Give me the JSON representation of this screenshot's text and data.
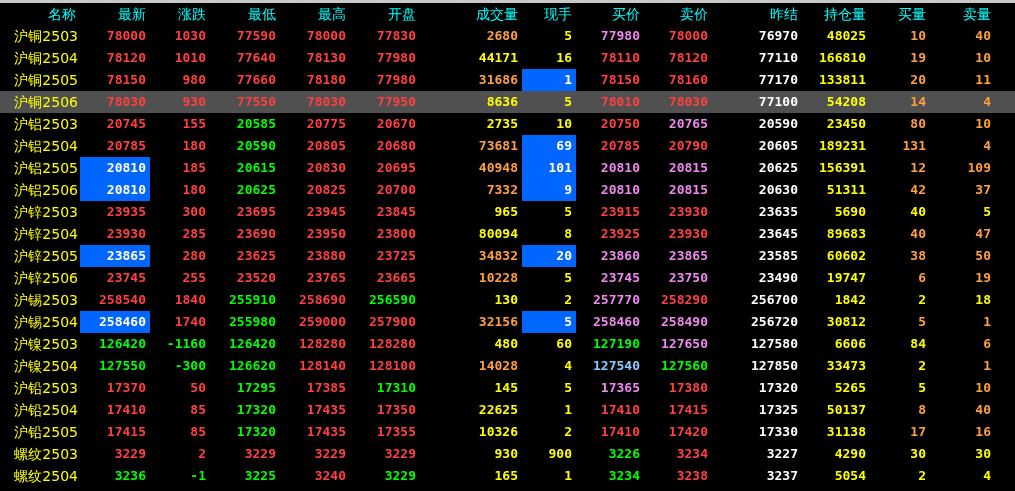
{
  "table": {
    "name_header": "名称",
    "columns": [
      {
        "label": "最新"
      },
      {
        "label": "涨跌"
      },
      {
        "label": "最低"
      },
      {
        "label": "最高"
      },
      {
        "label": "开盘"
      },
      {
        "label": "成交量"
      },
      {
        "label": "现手"
      },
      {
        "label": "买价"
      },
      {
        "label": "卖价"
      },
      {
        "label": "昨结"
      },
      {
        "label": "持仓量"
      },
      {
        "label": "买量"
      },
      {
        "label": "卖量"
      }
    ],
    "rows": [
      {
        "name": "沪铜2503",
        "selected": false,
        "cells": [
          {
            "text": "78000",
            "color": "#ff4040",
            "highlighted": false
          },
          {
            "text": "1030",
            "color": "#ff4040",
            "highlighted": false
          },
          {
            "text": "77590",
            "color": "#ff4040",
            "highlighted": false
          },
          {
            "text": "78000",
            "color": "#ff4040",
            "highlighted": false
          },
          {
            "text": "77830",
            "color": "#ff4040",
            "highlighted": false
          },
          {
            "text": "2680",
            "color": "#ffa040",
            "highlighted": false
          },
          {
            "text": "5",
            "color": "#ffff00",
            "highlighted": false
          },
          {
            "text": "77980",
            "color": "#ee88ee",
            "highlighted": false
          },
          {
            "text": "78000",
            "color": "#ff4040",
            "highlighted": false
          },
          {
            "text": "76970",
            "color": "#ffffff",
            "highlighted": false
          },
          {
            "text": "48025",
            "color": "#ffff00",
            "highlighted": false
          },
          {
            "text": "10",
            "color": "#ffa040",
            "highlighted": false
          },
          {
            "text": "40",
            "color": "#ffa040",
            "highlighted": false
          }
        ]
      },
      {
        "name": "沪铜2504",
        "selected": false,
        "cells": [
          {
            "text": "78120",
            "color": "#ff4040",
            "highlighted": false
          },
          {
            "text": "1010",
            "color": "#ff4040",
            "highlighted": false
          },
          {
            "text": "77640",
            "color": "#ff4040",
            "highlighted": false
          },
          {
            "text": "78130",
            "color": "#ff4040",
            "highlighted": false
          },
          {
            "text": "77980",
            "color": "#ff4040",
            "highlighted": false
          },
          {
            "text": "44171",
            "color": "#ffff00",
            "highlighted": false
          },
          {
            "text": "16",
            "color": "#ffff00",
            "highlighted": false
          },
          {
            "text": "78110",
            "color": "#ff4040",
            "highlighted": false
          },
          {
            "text": "78120",
            "color": "#ff4040",
            "highlighted": false
          },
          {
            "text": "77110",
            "color": "#ffffff",
            "highlighted": false
          },
          {
            "text": "166810",
            "color": "#ffff00",
            "highlighted": false
          },
          {
            "text": "19",
            "color": "#ffa040",
            "highlighted": false
          },
          {
            "text": "10",
            "color": "#ffa040",
            "highlighted": false
          }
        ]
      },
      {
        "name": "沪铜2505",
        "selected": false,
        "cells": [
          {
            "text": "78150",
            "color": "#ff4040",
            "highlighted": false
          },
          {
            "text": "980",
            "color": "#ff4040",
            "highlighted": false
          },
          {
            "text": "77660",
            "color": "#ff4040",
            "highlighted": false
          },
          {
            "text": "78180",
            "color": "#ff4040",
            "highlighted": false
          },
          {
            "text": "77980",
            "color": "#ff4040",
            "highlighted": false
          },
          {
            "text": "31686",
            "color": "#ffa040",
            "highlighted": false
          },
          {
            "text": "1",
            "color": "#ffffff",
            "highlighted": true
          },
          {
            "text": "78150",
            "color": "#ff4040",
            "highlighted": false
          },
          {
            "text": "78160",
            "color": "#ff4040",
            "highlighted": false
          },
          {
            "text": "77170",
            "color": "#ffffff",
            "highlighted": false
          },
          {
            "text": "133811",
            "color": "#ffff00",
            "highlighted": false
          },
          {
            "text": "20",
            "color": "#ffa040",
            "highlighted": false
          },
          {
            "text": "11",
            "color": "#ffa040",
            "highlighted": false
          }
        ]
      },
      {
        "name": "沪铜2506",
        "selected": true,
        "cells": [
          {
            "text": "78030",
            "color": "#ff4040",
            "highlighted": false
          },
          {
            "text": "930",
            "color": "#ff4040",
            "highlighted": false
          },
          {
            "text": "77550",
            "color": "#ff4040",
            "highlighted": false
          },
          {
            "text": "78030",
            "color": "#ff4040",
            "highlighted": false
          },
          {
            "text": "77950",
            "color": "#ff4040",
            "highlighted": false
          },
          {
            "text": "8636",
            "color": "#ffff00",
            "highlighted": false
          },
          {
            "text": "5",
            "color": "#ffff00",
            "highlighted": false
          },
          {
            "text": "78010",
            "color": "#ff4040",
            "highlighted": false
          },
          {
            "text": "78030",
            "color": "#ff4040",
            "highlighted": false
          },
          {
            "text": "77100",
            "color": "#ffffff",
            "highlighted": false
          },
          {
            "text": "54208",
            "color": "#ffff00",
            "highlighted": false
          },
          {
            "text": "14",
            "color": "#ffa040",
            "highlighted": false
          },
          {
            "text": "4",
            "color": "#ffa040",
            "highlighted": false
          }
        ]
      },
      {
        "name": "沪铝2503",
        "selected": false,
        "cells": [
          {
            "text": "20745",
            "color": "#ff4040",
            "highlighted": false
          },
          {
            "text": "155",
            "color": "#ff4040",
            "highlighted": false
          },
          {
            "text": "20585",
            "color": "#00ff00",
            "highlighted": false
          },
          {
            "text": "20775",
            "color": "#ff4040",
            "highlighted": false
          },
          {
            "text": "20670",
            "color": "#ff4040",
            "highlighted": false
          },
          {
            "text": "2735",
            "color": "#ffff00",
            "highlighted": false
          },
          {
            "text": "10",
            "color": "#ffff00",
            "highlighted": false
          },
          {
            "text": "20750",
            "color": "#ff4040",
            "highlighted": false
          },
          {
            "text": "20765",
            "color": "#ee88ee",
            "highlighted": false
          },
          {
            "text": "20590",
            "color": "#ffffff",
            "highlighted": false
          },
          {
            "text": "23450",
            "color": "#ffff00",
            "highlighted": false
          },
          {
            "text": "80",
            "color": "#ffa040",
            "highlighted": false
          },
          {
            "text": "10",
            "color": "#ffa040",
            "highlighted": false
          }
        ]
      },
      {
        "name": "沪铝2504",
        "selected": false,
        "cells": [
          {
            "text": "20785",
            "color": "#ff4040",
            "highlighted": false
          },
          {
            "text": "180",
            "color": "#ff4040",
            "highlighted": false
          },
          {
            "text": "20590",
            "color": "#00ff00",
            "highlighted": false
          },
          {
            "text": "20805",
            "color": "#ff4040",
            "highlighted": false
          },
          {
            "text": "20680",
            "color": "#ff4040",
            "highlighted": false
          },
          {
            "text": "73681",
            "color": "#ffa040",
            "highlighted": false
          },
          {
            "text": "69",
            "color": "#ffffff",
            "highlighted": true
          },
          {
            "text": "20785",
            "color": "#ff4040",
            "highlighted": false
          },
          {
            "text": "20790",
            "color": "#ff4040",
            "highlighted": false
          },
          {
            "text": "20605",
            "color": "#ffffff",
            "highlighted": false
          },
          {
            "text": "189231",
            "color": "#ffff00",
            "highlighted": false
          },
          {
            "text": "131",
            "color": "#ffa040",
            "highlighted": false
          },
          {
            "text": "4",
            "color": "#ffa040",
            "highlighted": false
          }
        ]
      },
      {
        "name": "沪铝2505",
        "selected": false,
        "cells": [
          {
            "text": "20810",
            "color": "#ffffff",
            "highlighted": true
          },
          {
            "text": "185",
            "color": "#ff4040",
            "highlighted": false
          },
          {
            "text": "20615",
            "color": "#00ff00",
            "highlighted": false
          },
          {
            "text": "20830",
            "color": "#ff4040",
            "highlighted": false
          },
          {
            "text": "20695",
            "color": "#ff4040",
            "highlighted": false
          },
          {
            "text": "40948",
            "color": "#ffa040",
            "highlighted": false
          },
          {
            "text": "101",
            "color": "#ffffff",
            "highlighted": true
          },
          {
            "text": "20810",
            "color": "#ee88ee",
            "highlighted": false
          },
          {
            "text": "20815",
            "color": "#ee88ee",
            "highlighted": false
          },
          {
            "text": "20625",
            "color": "#ffffff",
            "highlighted": false
          },
          {
            "text": "156391",
            "color": "#ffff00",
            "highlighted": false
          },
          {
            "text": "12",
            "color": "#ffa040",
            "highlighted": false
          },
          {
            "text": "109",
            "color": "#ffa040",
            "highlighted": false
          }
        ]
      },
      {
        "name": "沪铝2506",
        "selected": false,
        "cells": [
          {
            "text": "20810",
            "color": "#ffffff",
            "highlighted": true
          },
          {
            "text": "180",
            "color": "#ff4040",
            "highlighted": false
          },
          {
            "text": "20625",
            "color": "#00ff00",
            "highlighted": false
          },
          {
            "text": "20825",
            "color": "#ff4040",
            "highlighted": false
          },
          {
            "text": "20700",
            "color": "#ff4040",
            "highlighted": false
          },
          {
            "text": "7332",
            "color": "#ffa040",
            "highlighted": false
          },
          {
            "text": "9",
            "color": "#ffffff",
            "highlighted": true
          },
          {
            "text": "20810",
            "color": "#ee88ee",
            "highlighted": false
          },
          {
            "text": "20815",
            "color": "#ee88ee",
            "highlighted": false
          },
          {
            "text": "20630",
            "color": "#ffffff",
            "highlighted": false
          },
          {
            "text": "51311",
            "color": "#ffff00",
            "highlighted": false
          },
          {
            "text": "42",
            "color": "#ffa040",
            "highlighted": false
          },
          {
            "text": "37",
            "color": "#ffa040",
            "highlighted": false
          }
        ]
      },
      {
        "name": "沪锌2503",
        "selected": false,
        "cells": [
          {
            "text": "23935",
            "color": "#ff4040",
            "highlighted": false
          },
          {
            "text": "300",
            "color": "#ff4040",
            "highlighted": false
          },
          {
            "text": "23695",
            "color": "#ff4040",
            "highlighted": false
          },
          {
            "text": "23945",
            "color": "#ff4040",
            "highlighted": false
          },
          {
            "text": "23845",
            "color": "#ff4040",
            "highlighted": false
          },
          {
            "text": "965",
            "color": "#ffff00",
            "highlighted": false
          },
          {
            "text": "5",
            "color": "#ffff00",
            "highlighted": false
          },
          {
            "text": "23915",
            "color": "#ff4040",
            "highlighted": false
          },
          {
            "text": "23930",
            "color": "#ff4040",
            "highlighted": false
          },
          {
            "text": "23635",
            "color": "#ffffff",
            "highlighted": false
          },
          {
            "text": "5690",
            "color": "#ffff00",
            "highlighted": false
          },
          {
            "text": "40",
            "color": "#ffff00",
            "highlighted": false
          },
          {
            "text": "5",
            "color": "#ffff00",
            "highlighted": false
          }
        ]
      },
      {
        "name": "沪锌2504",
        "selected": false,
        "cells": [
          {
            "text": "23930",
            "color": "#ff4040",
            "highlighted": false
          },
          {
            "text": "285",
            "color": "#ff4040",
            "highlighted": false
          },
          {
            "text": "23690",
            "color": "#ff4040",
            "highlighted": false
          },
          {
            "text": "23950",
            "color": "#ff4040",
            "highlighted": false
          },
          {
            "text": "23800",
            "color": "#ff4040",
            "highlighted": false
          },
          {
            "text": "80094",
            "color": "#ffff00",
            "highlighted": false
          },
          {
            "text": "8",
            "color": "#ffff00",
            "highlighted": false
          },
          {
            "text": "23925",
            "color": "#ff4040",
            "highlighted": false
          },
          {
            "text": "23930",
            "color": "#ff4040",
            "highlighted": false
          },
          {
            "text": "23645",
            "color": "#ffffff",
            "highlighted": false
          },
          {
            "text": "89683",
            "color": "#ffff00",
            "highlighted": false
          },
          {
            "text": "40",
            "color": "#ffa040",
            "highlighted": false
          },
          {
            "text": "47",
            "color": "#ffa040",
            "highlighted": false
          }
        ]
      },
      {
        "name": "沪锌2505",
        "selected": false,
        "cells": [
          {
            "text": "23865",
            "color": "#ffffff",
            "highlighted": true
          },
          {
            "text": "280",
            "color": "#ff4040",
            "highlighted": false
          },
          {
            "text": "23625",
            "color": "#ff4040",
            "highlighted": false
          },
          {
            "text": "23880",
            "color": "#ff4040",
            "highlighted": false
          },
          {
            "text": "23725",
            "color": "#ff4040",
            "highlighted": false
          },
          {
            "text": "34832",
            "color": "#ffa040",
            "highlighted": false
          },
          {
            "text": "20",
            "color": "#ffffff",
            "highlighted": true
          },
          {
            "text": "23860",
            "color": "#ee88ee",
            "highlighted": false
          },
          {
            "text": "23865",
            "color": "#ee88ee",
            "highlighted": false
          },
          {
            "text": "23585",
            "color": "#ffffff",
            "highlighted": false
          },
          {
            "text": "60602",
            "color": "#ffff00",
            "highlighted": false
          },
          {
            "text": "38",
            "color": "#ffa040",
            "highlighted": false
          },
          {
            "text": "50",
            "color": "#ffa040",
            "highlighted": false
          }
        ]
      },
      {
        "name": "沪锌2506",
        "selected": false,
        "cells": [
          {
            "text": "23745",
            "color": "#ff4040",
            "highlighted": false
          },
          {
            "text": "255",
            "color": "#ff4040",
            "highlighted": false
          },
          {
            "text": "23520",
            "color": "#ff4040",
            "highlighted": false
          },
          {
            "text": "23765",
            "color": "#ff4040",
            "highlighted": false
          },
          {
            "text": "23665",
            "color": "#ff4040",
            "highlighted": false
          },
          {
            "text": "10228",
            "color": "#ffa040",
            "highlighted": false
          },
          {
            "text": "5",
            "color": "#ffff00",
            "highlighted": false
          },
          {
            "text": "23745",
            "color": "#ee88ee",
            "highlighted": false
          },
          {
            "text": "23750",
            "color": "#ee88ee",
            "highlighted": false
          },
          {
            "text": "23490",
            "color": "#ffffff",
            "highlighted": false
          },
          {
            "text": "19747",
            "color": "#ffff00",
            "highlighted": false
          },
          {
            "text": "6",
            "color": "#ffa040",
            "highlighted": false
          },
          {
            "text": "19",
            "color": "#ffa040",
            "highlighted": false
          }
        ]
      },
      {
        "name": "沪锡2503",
        "selected": false,
        "cells": [
          {
            "text": "258540",
            "color": "#ff4040",
            "highlighted": false
          },
          {
            "text": "1840",
            "color": "#ff4040",
            "highlighted": false
          },
          {
            "text": "255910",
            "color": "#00ff00",
            "highlighted": false
          },
          {
            "text": "258690",
            "color": "#ff4040",
            "highlighted": false
          },
          {
            "text": "256590",
            "color": "#00ff00",
            "highlighted": false
          },
          {
            "text": "130",
            "color": "#ffff00",
            "highlighted": false
          },
          {
            "text": "2",
            "color": "#ffff00",
            "highlighted": false
          },
          {
            "text": "257770",
            "color": "#ee88ee",
            "highlighted": false
          },
          {
            "text": "258290",
            "color": "#ff4040",
            "highlighted": false
          },
          {
            "text": "256700",
            "color": "#ffffff",
            "highlighted": false
          },
          {
            "text": "1842",
            "color": "#ffff00",
            "highlighted": false
          },
          {
            "text": "2",
            "color": "#ffff00",
            "highlighted": false
          },
          {
            "text": "18",
            "color": "#ffff00",
            "highlighted": false
          }
        ]
      },
      {
        "name": "沪锡2504",
        "selected": false,
        "cells": [
          {
            "text": "258460",
            "color": "#ffffff",
            "highlighted": true
          },
          {
            "text": "1740",
            "color": "#ff4040",
            "highlighted": false
          },
          {
            "text": "255980",
            "color": "#00ff00",
            "highlighted": false
          },
          {
            "text": "259000",
            "color": "#ff4040",
            "highlighted": false
          },
          {
            "text": "257900",
            "color": "#ff4040",
            "highlighted": false
          },
          {
            "text": "32156",
            "color": "#ffa040",
            "highlighted": false
          },
          {
            "text": "5",
            "color": "#ffffff",
            "highlighted": true
          },
          {
            "text": "258460",
            "color": "#ee88ee",
            "highlighted": false
          },
          {
            "text": "258490",
            "color": "#ee88ee",
            "highlighted": false
          },
          {
            "text": "256720",
            "color": "#ffffff",
            "highlighted": false
          },
          {
            "text": "30812",
            "color": "#ffff00",
            "highlighted": false
          },
          {
            "text": "5",
            "color": "#ffa040",
            "highlighted": false
          },
          {
            "text": "1",
            "color": "#ffa040",
            "highlighted": false
          }
        ]
      },
      {
        "name": "沪镍2503",
        "selected": false,
        "cells": [
          {
            "text": "126420",
            "color": "#00ff00",
            "highlighted": false
          },
          {
            "text": "-1160",
            "color": "#00ff00",
            "highlighted": false
          },
          {
            "text": "126420",
            "color": "#00ff00",
            "highlighted": false
          },
          {
            "text": "128280",
            "color": "#ff4040",
            "highlighted": false
          },
          {
            "text": "128280",
            "color": "#ff4040",
            "highlighted": false
          },
          {
            "text": "480",
            "color": "#ffff00",
            "highlighted": false
          },
          {
            "text": "60",
            "color": "#ffff00",
            "highlighted": false
          },
          {
            "text": "127190",
            "color": "#00ff00",
            "highlighted": false
          },
          {
            "text": "127650",
            "color": "#ee88ee",
            "highlighted": false
          },
          {
            "text": "127580",
            "color": "#ffffff",
            "highlighted": false
          },
          {
            "text": "6606",
            "color": "#ffff00",
            "highlighted": false
          },
          {
            "text": "84",
            "color": "#ffff00",
            "highlighted": false
          },
          {
            "text": "6",
            "color": "#ffa040",
            "highlighted": false
          }
        ]
      },
      {
        "name": "沪镍2504",
        "selected": false,
        "cells": [
          {
            "text": "127550",
            "color": "#00ff00",
            "highlighted": false
          },
          {
            "text": "-300",
            "color": "#00ff00",
            "highlighted": false
          },
          {
            "text": "126620",
            "color": "#00ff00",
            "highlighted": false
          },
          {
            "text": "128140",
            "color": "#ff4040",
            "highlighted": false
          },
          {
            "text": "128100",
            "color": "#ff4040",
            "highlighted": false
          },
          {
            "text": "14028",
            "color": "#ffa040",
            "highlighted": false
          },
          {
            "text": "4",
            "color": "#ffff00",
            "highlighted": false
          },
          {
            "text": "127540",
            "color": "#88ccff",
            "highlighted": false
          },
          {
            "text": "127560",
            "color": "#00ff00",
            "highlighted": false
          },
          {
            "text": "127850",
            "color": "#ffffff",
            "highlighted": false
          },
          {
            "text": "33473",
            "color": "#ffff00",
            "highlighted": false
          },
          {
            "text": "2",
            "color": "#ffff00",
            "highlighted": false
          },
          {
            "text": "1",
            "color": "#ffa040",
            "highlighted": false
          }
        ]
      },
      {
        "name": "沪铅2503",
        "selected": false,
        "cells": [
          {
            "text": "17370",
            "color": "#ff4040",
            "highlighted": false
          },
          {
            "text": "50",
            "color": "#ff4040",
            "highlighted": false
          },
          {
            "text": "17295",
            "color": "#00ff00",
            "highlighted": false
          },
          {
            "text": "17385",
            "color": "#ff4040",
            "highlighted": false
          },
          {
            "text": "17310",
            "color": "#00ff00",
            "highlighted": false
          },
          {
            "text": "145",
            "color": "#ffff00",
            "highlighted": false
          },
          {
            "text": "5",
            "color": "#ffff00",
            "highlighted": false
          },
          {
            "text": "17365",
            "color": "#ee88ee",
            "highlighted": false
          },
          {
            "text": "17380",
            "color": "#ff4040",
            "highlighted": false
          },
          {
            "text": "17320",
            "color": "#ffffff",
            "highlighted": false
          },
          {
            "text": "5265",
            "color": "#ffff00",
            "highlighted": false
          },
          {
            "text": "5",
            "color": "#ffff00",
            "highlighted": false
          },
          {
            "text": "10",
            "color": "#ffa040",
            "highlighted": false
          }
        ]
      },
      {
        "name": "沪铅2504",
        "selected": false,
        "cells": [
          {
            "text": "17410",
            "color": "#ff4040",
            "highlighted": false
          },
          {
            "text": "85",
            "color": "#ff4040",
            "highlighted": false
          },
          {
            "text": "17320",
            "color": "#00ff00",
            "highlighted": false
          },
          {
            "text": "17435",
            "color": "#ff4040",
            "highlighted": false
          },
          {
            "text": "17350",
            "color": "#ff4040",
            "highlighted": false
          },
          {
            "text": "22625",
            "color": "#ffff00",
            "highlighted": false
          },
          {
            "text": "1",
            "color": "#ffff00",
            "highlighted": false
          },
          {
            "text": "17410",
            "color": "#ff4040",
            "highlighted": false
          },
          {
            "text": "17415",
            "color": "#ff4040",
            "highlighted": false
          },
          {
            "text": "17325",
            "color": "#ffffff",
            "highlighted": false
          },
          {
            "text": "50137",
            "color": "#ffff00",
            "highlighted": false
          },
          {
            "text": "8",
            "color": "#ffa040",
            "highlighted": false
          },
          {
            "text": "40",
            "color": "#ffa040",
            "highlighted": false
          }
        ]
      },
      {
        "name": "沪铅2505",
        "selected": false,
        "cells": [
          {
            "text": "17415",
            "color": "#ff4040",
            "highlighted": false
          },
          {
            "text": "85",
            "color": "#ff4040",
            "highlighted": false
          },
          {
            "text": "17320",
            "color": "#00ff00",
            "highlighted": false
          },
          {
            "text": "17435",
            "color": "#ff4040",
            "highlighted": false
          },
          {
            "text": "17355",
            "color": "#ff4040",
            "highlighted": false
          },
          {
            "text": "10326",
            "color": "#ffff00",
            "highlighted": false
          },
          {
            "text": "2",
            "color": "#ffff00",
            "highlighted": false
          },
          {
            "text": "17410",
            "color": "#ff4040",
            "highlighted": false
          },
          {
            "text": "17420",
            "color": "#ff4040",
            "highlighted": false
          },
          {
            "text": "17330",
            "color": "#ffffff",
            "highlighted": false
          },
          {
            "text": "31138",
            "color": "#ffff00",
            "highlighted": false
          },
          {
            "text": "17",
            "color": "#ffa040",
            "highlighted": false
          },
          {
            "text": "16",
            "color": "#ffa040",
            "highlighted": false
          }
        ]
      },
      {
        "name": "螺纹2503",
        "selected": false,
        "cells": [
          {
            "text": "3229",
            "color": "#ff4040",
            "highlighted": false
          },
          {
            "text": "2",
            "color": "#ff4040",
            "highlighted": false
          },
          {
            "text": "3229",
            "color": "#ff4040",
            "highlighted": false
          },
          {
            "text": "3229",
            "color": "#ff4040",
            "highlighted": false
          },
          {
            "text": "3229",
            "color": "#ff4040",
            "highlighted": false
          },
          {
            "text": "930",
            "color": "#ffff00",
            "highlighted": false
          },
          {
            "text": "900",
            "color": "#ffff00",
            "highlighted": false
          },
          {
            "text": "3226",
            "color": "#00ff00",
            "highlighted": false
          },
          {
            "text": "3234",
            "color": "#ff4040",
            "highlighted": false
          },
          {
            "text": "3227",
            "color": "#ffffff",
            "highlighted": false
          },
          {
            "text": "4290",
            "color": "#ffff00",
            "highlighted": false
          },
          {
            "text": "30",
            "color": "#ffff00",
            "highlighted": false
          },
          {
            "text": "30",
            "color": "#ffff00",
            "highlighted": false
          }
        ]
      },
      {
        "name": "螺纹2504",
        "selected": false,
        "cells": [
          {
            "text": "3236",
            "color": "#00ff00",
            "highlighted": false
          },
          {
            "text": "-1",
            "color": "#00ff00",
            "highlighted": false
          },
          {
            "text": "3225",
            "color": "#00ff00",
            "highlighted": false
          },
          {
            "text": "3240",
            "color": "#ff4040",
            "highlighted": false
          },
          {
            "text": "3229",
            "color": "#00ff00",
            "highlighted": false
          },
          {
            "text": "165",
            "color": "#ffff00",
            "highlighted": false
          },
          {
            "text": "1",
            "color": "#ffff00",
            "highlighted": false
          },
          {
            "text": "3234",
            "color": "#00ff00",
            "highlighted": false
          },
          {
            "text": "3238",
            "color": "#ff4040",
            "highlighted": false
          },
          {
            "text": "3237",
            "color": "#ffffff",
            "highlighted": false
          },
          {
            "text": "5054",
            "color": "#ffff00",
            "highlighted": false
          },
          {
            "text": "2",
            "color": "#ffff00",
            "highlighted": false
          },
          {
            "text": "4",
            "color": "#ffff00",
            "highlighted": false
          }
        ]
      }
    ]
  }
}
